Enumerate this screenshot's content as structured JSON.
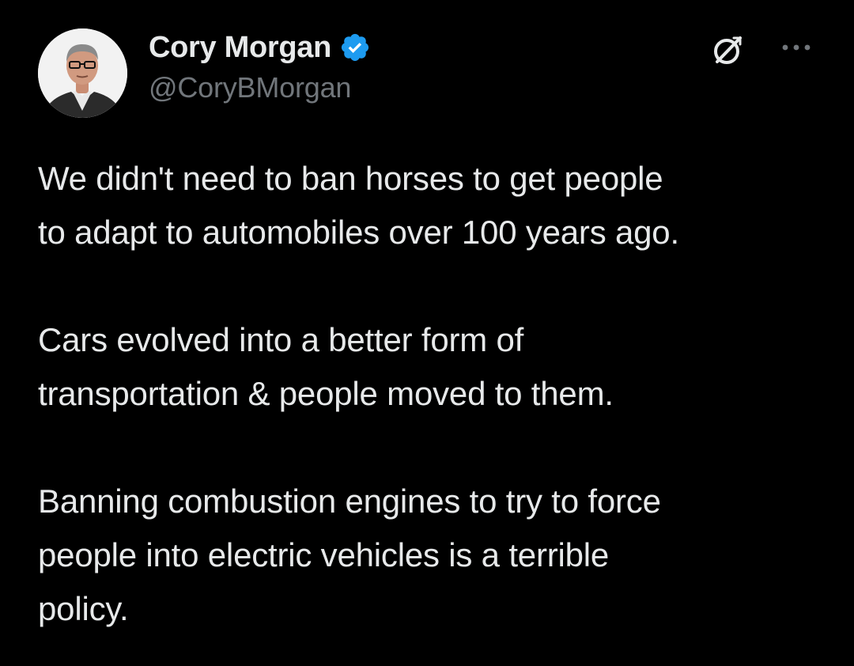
{
  "tweet": {
    "author": {
      "display_name": "Cory Morgan",
      "handle": "@CoryBMorgan",
      "verified": true,
      "verified_color": "#1d9bf0"
    },
    "icons": {
      "grok": "grok-icon",
      "more": "more-options-icon"
    },
    "paragraphs": [
      "We didn't need to ban horses to get people\nto adapt to automobiles over 100 years ago.",
      "Cars evolved into a better form of\ntransportation & people moved to them.",
      "Banning combustion engines to try to force\npeople into electric vehicles is a terrible\npolicy."
    ]
  },
  "theme": {
    "background": "#000000",
    "text": "#e7e9ea",
    "secondary_text": "#71767b"
  }
}
